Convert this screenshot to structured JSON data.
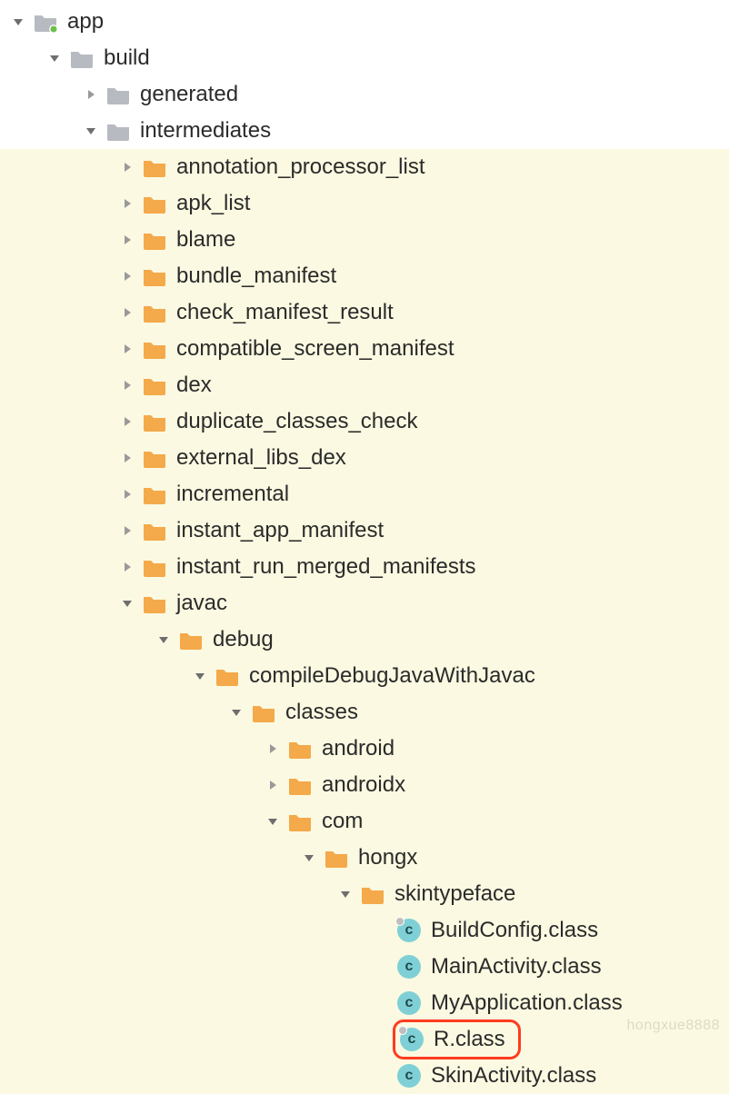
{
  "colors": {
    "folder_grey": "#b7bbc1",
    "folder_orange": "#f4a94a",
    "arrow_grey": "#8a8a8a",
    "highlight_bg": "#fbf9e1",
    "highlight_border": "#ff3b1f",
    "class_badge": "#7fd0d6",
    "module_dot": "#6cc04a"
  },
  "watermark": "hongxue8888",
  "tree": [
    {
      "depth": 0,
      "expanded": true,
      "icon": "module-folder",
      "label": "app",
      "hl": false
    },
    {
      "depth": 1,
      "expanded": true,
      "icon": "folder-grey",
      "label": "build",
      "hl": false
    },
    {
      "depth": 2,
      "expanded": false,
      "icon": "folder-grey",
      "label": "generated",
      "hl": false
    },
    {
      "depth": 2,
      "expanded": true,
      "icon": "folder-grey",
      "label": "intermediates",
      "hl": false
    },
    {
      "depth": 3,
      "expanded": false,
      "icon": "folder-orange",
      "label": "annotation_processor_list",
      "hl": true
    },
    {
      "depth": 3,
      "expanded": false,
      "icon": "folder-orange",
      "label": "apk_list",
      "hl": true
    },
    {
      "depth": 3,
      "expanded": false,
      "icon": "folder-orange",
      "label": "blame",
      "hl": true
    },
    {
      "depth": 3,
      "expanded": false,
      "icon": "folder-orange",
      "label": "bundle_manifest",
      "hl": true
    },
    {
      "depth": 3,
      "expanded": false,
      "icon": "folder-orange",
      "label": "check_manifest_result",
      "hl": true
    },
    {
      "depth": 3,
      "expanded": false,
      "icon": "folder-orange",
      "label": "compatible_screen_manifest",
      "hl": true
    },
    {
      "depth": 3,
      "expanded": false,
      "icon": "folder-orange",
      "label": "dex",
      "hl": true
    },
    {
      "depth": 3,
      "expanded": false,
      "icon": "folder-orange",
      "label": "duplicate_classes_check",
      "hl": true
    },
    {
      "depth": 3,
      "expanded": false,
      "icon": "folder-orange",
      "label": "external_libs_dex",
      "hl": true
    },
    {
      "depth": 3,
      "expanded": false,
      "icon": "folder-orange",
      "label": "incremental",
      "hl": true
    },
    {
      "depth": 3,
      "expanded": false,
      "icon": "folder-orange",
      "label": "instant_app_manifest",
      "hl": true
    },
    {
      "depth": 3,
      "expanded": false,
      "icon": "folder-orange",
      "label": "instant_run_merged_manifests",
      "hl": true
    },
    {
      "depth": 3,
      "expanded": true,
      "icon": "folder-orange",
      "label": "javac",
      "hl": true
    },
    {
      "depth": 4,
      "expanded": true,
      "icon": "folder-orange",
      "label": "debug",
      "hl": true
    },
    {
      "depth": 5,
      "expanded": true,
      "icon": "folder-orange",
      "label": "compileDebugJavaWithJavac",
      "hl": true
    },
    {
      "depth": 6,
      "expanded": true,
      "icon": "folder-orange",
      "label": "classes",
      "hl": true
    },
    {
      "depth": 7,
      "expanded": false,
      "icon": "folder-orange",
      "label": "android",
      "hl": true
    },
    {
      "depth": 7,
      "expanded": false,
      "icon": "folder-orange",
      "label": "androidx",
      "hl": true
    },
    {
      "depth": 7,
      "expanded": true,
      "icon": "folder-orange",
      "label": "com",
      "hl": true
    },
    {
      "depth": 8,
      "expanded": true,
      "icon": "folder-orange",
      "label": "hongx",
      "hl": true
    },
    {
      "depth": 9,
      "expanded": true,
      "icon": "folder-orange",
      "label": "skintypeface",
      "hl": true
    },
    {
      "depth": 10,
      "expanded": null,
      "icon": "class-dot",
      "label": "BuildConfig.class",
      "hl": true
    },
    {
      "depth": 10,
      "expanded": null,
      "icon": "class",
      "label": "MainActivity.class",
      "hl": true
    },
    {
      "depth": 10,
      "expanded": null,
      "icon": "class",
      "label": "MyApplication.class",
      "hl": true
    },
    {
      "depth": 10,
      "expanded": null,
      "icon": "class-dot",
      "label": "R.class",
      "hl": true,
      "boxed": true
    },
    {
      "depth": 10,
      "expanded": null,
      "icon": "class",
      "label": "SkinActivity.class",
      "hl": true
    }
  ]
}
